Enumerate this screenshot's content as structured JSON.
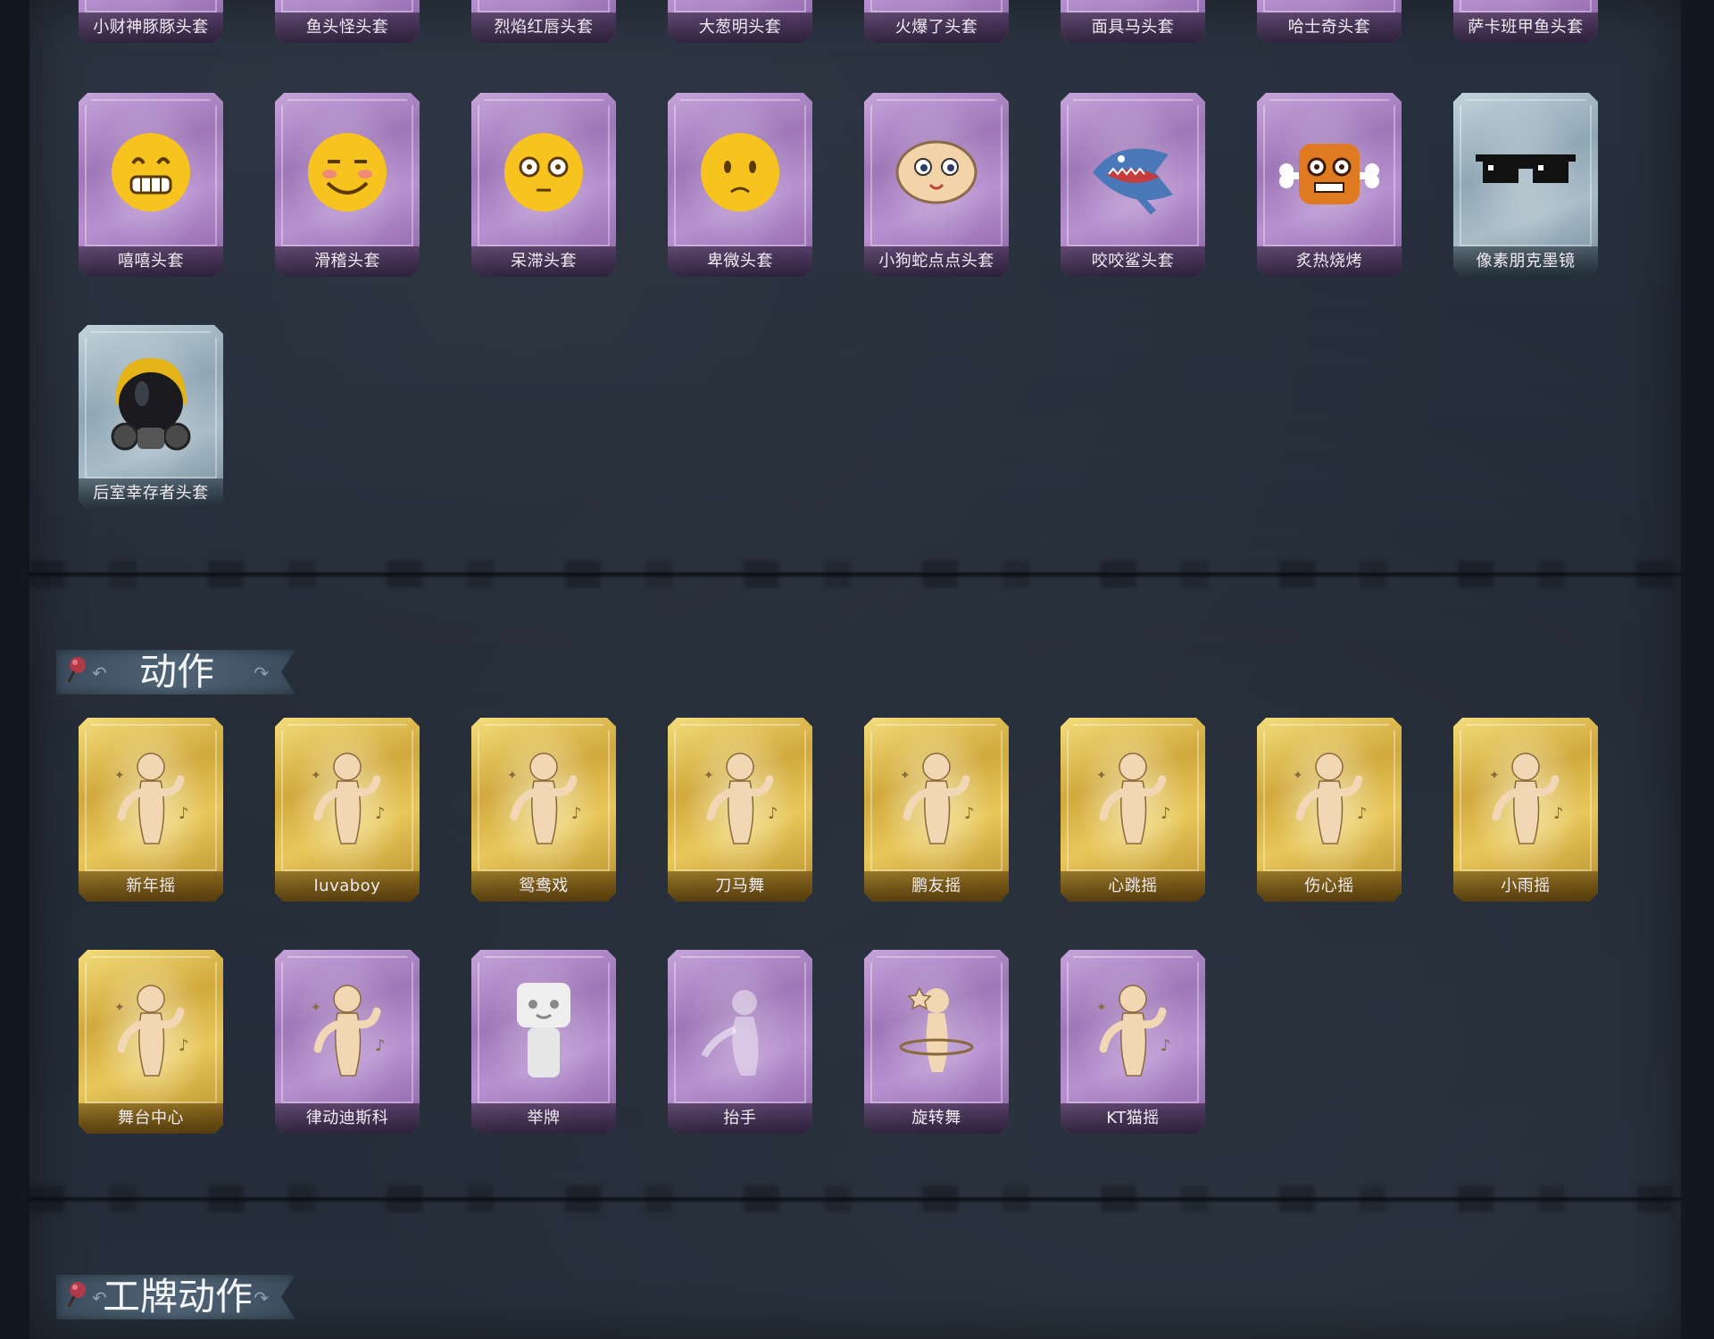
{
  "sections": {
    "motion": {
      "title": "动作"
    },
    "badge_motion": {
      "title": "工牌动作"
    }
  },
  "headwear_row_top": [
    {
      "label": "小财神豚豚头套",
      "rarity": "purple",
      "icon": "piggy-mask-icon"
    },
    {
      "label": "鱼头怪头套",
      "rarity": "purple",
      "icon": "fish-head-icon"
    },
    {
      "label": "烈焰红唇头套",
      "rarity": "purple",
      "icon": "red-lips-icon"
    },
    {
      "label": "大葱明头套",
      "rarity": "purple",
      "icon": "scallion-head-icon"
    },
    {
      "label": "火爆了头套",
      "rarity": "purple",
      "icon": "fire-head-icon"
    },
    {
      "label": "面具马头套",
      "rarity": "purple",
      "icon": "horse-mask-icon"
    },
    {
      "label": "哈士奇头套",
      "rarity": "purple",
      "icon": "husky-head-icon"
    },
    {
      "label": "萨卡班甲鱼头套",
      "rarity": "purple",
      "icon": "sacabambaspis-head-icon"
    }
  ],
  "headwear_row_2": [
    {
      "label": "嘻嘻头套",
      "rarity": "purple",
      "icon": "grinning-emoji-icon"
    },
    {
      "label": "滑稽头套",
      "rarity": "purple",
      "icon": "smirk-emoji-icon"
    },
    {
      "label": "呆滞头套",
      "rarity": "purple",
      "icon": "dazed-emoji-icon"
    },
    {
      "label": "卑微头套",
      "rarity": "purple",
      "icon": "humble-emoji-icon"
    },
    {
      "label": "小狗蛇点点头套",
      "rarity": "purple",
      "icon": "puppy-snake-icon"
    },
    {
      "label": "咬咬鲨头套",
      "rarity": "purple",
      "icon": "shark-head-icon"
    },
    {
      "label": "炙热烧烤",
      "rarity": "purple",
      "icon": "roast-meat-icon"
    },
    {
      "label": "像素朋克墨镜",
      "rarity": "blue",
      "icon": "pixel-sunglasses-icon"
    }
  ],
  "headwear_row_3": [
    {
      "label": "后室幸存者头套",
      "rarity": "blue",
      "icon": "gas-mask-helmet-icon"
    }
  ],
  "motion_row_1": [
    {
      "label": "新年摇",
      "rarity": "gold",
      "icon": "dance-pose-icon"
    },
    {
      "label": "luvaboy",
      "rarity": "gold",
      "icon": "dance-pose-icon"
    },
    {
      "label": "鸳鸯戏",
      "rarity": "gold",
      "icon": "dance-pose-icon"
    },
    {
      "label": "刀马舞",
      "rarity": "gold",
      "icon": "dance-pose-icon"
    },
    {
      "label": "鹏友摇",
      "rarity": "gold",
      "icon": "dance-pose-icon"
    },
    {
      "label": "心跳摇",
      "rarity": "gold",
      "icon": "dance-pose-icon"
    },
    {
      "label": "伤心摇",
      "rarity": "gold",
      "icon": "dance-pose-icon"
    },
    {
      "label": "小雨摇",
      "rarity": "gold",
      "icon": "dance-pose-icon"
    }
  ],
  "motion_row_2": [
    {
      "label": "舞台中心",
      "rarity": "gold",
      "icon": "dance-pose-icon"
    },
    {
      "label": "律动迪斯科",
      "rarity": "purple",
      "icon": "dance-pose-icon"
    },
    {
      "label": "举牌",
      "rarity": "purple",
      "icon": "sign-holding-icon"
    },
    {
      "label": "抬手",
      "rarity": "purple",
      "icon": "raise-hand-icon"
    },
    {
      "label": "旋转舞",
      "rarity": "purple",
      "icon": "spin-dance-icon"
    },
    {
      "label": "KT猫摇",
      "rarity": "purple",
      "icon": "dance-pose-icon"
    }
  ],
  "colors": {
    "purple_card": "#b18acb",
    "gold_card": "#e3c158",
    "blue_card": "#a2b8c5",
    "panel": "#242c38",
    "banner": "#485b6c"
  }
}
